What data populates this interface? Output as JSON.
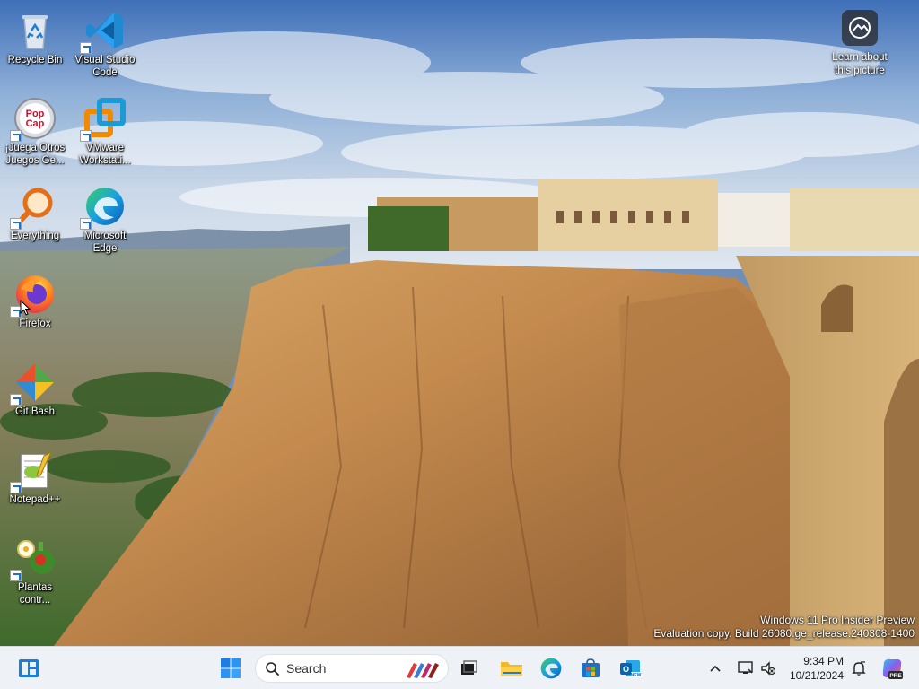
{
  "desktop": {
    "icons": [
      {
        "label": "Recycle Bin",
        "icon": "recycle-bin-icon"
      },
      {
        "label": "Visual Studio Code",
        "icon": "vscode-icon"
      },
      {
        "label": "¡Juega Otros Juegos Ge...",
        "icon": "popcap-icon"
      },
      {
        "label": "VMware Workstati...",
        "icon": "vmware-icon"
      },
      {
        "label": "Everything",
        "icon": "everything-search-icon"
      },
      {
        "label": "Microsoft Edge",
        "icon": "edge-icon"
      },
      {
        "label": "Firefox",
        "icon": "firefox-icon"
      },
      {
        "label": "Git Bash",
        "icon": "git-bash-icon"
      },
      {
        "label": "Notepad++",
        "icon": "notepad-plus-plus-icon"
      },
      {
        "label": "Plantas contr...",
        "icon": "plants-game-icon"
      }
    ],
    "learn_about": {
      "label_line1": "Learn about",
      "label_line2": "this picture"
    },
    "watermark": {
      "line1": "Windows 11 Pro Insider Preview",
      "line2": "Evaluation copy. Build 26080.ge_release.240308-1400"
    }
  },
  "taskbar": {
    "search_placeholder": "Search",
    "pinned": [
      "start-icon",
      "search-icon",
      "task-view-icon",
      "file-explorer-icon",
      "edge-icon",
      "microsoft-store-icon",
      "outlook-new-icon"
    ],
    "clock_time": "9:34 PM",
    "clock_date": "10/21/2024",
    "colors": {
      "taskbar_bg": "#eef2f7",
      "accent": "#0067c0"
    }
  }
}
